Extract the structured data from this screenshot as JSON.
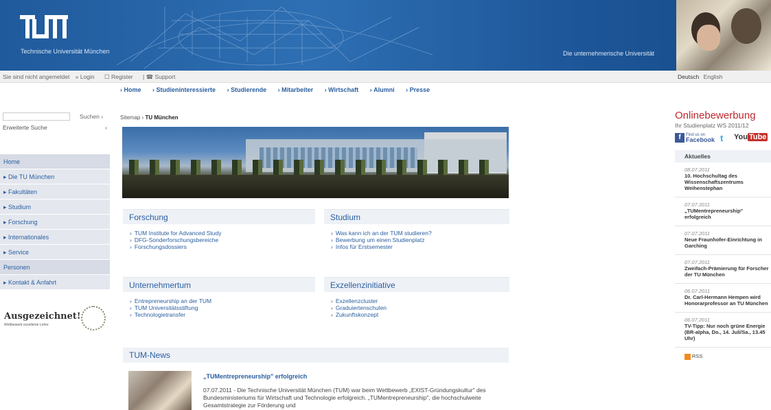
{
  "header": {
    "logo_text": "TUM",
    "university_name": "Technische Universität München",
    "slogan": "Die unternehmerische Universität"
  },
  "loginbar": {
    "status": "Sie sind nicht angemeldet",
    "login": "Login",
    "register": "Register",
    "support": "Support",
    "lang_de": "Deutsch",
    "lang_en": "English"
  },
  "topnav": [
    "Home",
    "Studieninteressierte",
    "Studierende",
    "Mitarbeiter",
    "Wirtschaft",
    "Alumni",
    "Presse"
  ],
  "sidebar": {
    "search_button": "Suchen",
    "advanced_search": "Erweiterte Suche",
    "items": [
      {
        "label": "Home",
        "arrow": false
      },
      {
        "label": "Die TU München",
        "arrow": true
      },
      {
        "label": "Fakultäten",
        "arrow": true
      },
      {
        "label": "Studium",
        "arrow": true
      },
      {
        "label": "Forschung",
        "arrow": true
      },
      {
        "label": "Internationales",
        "arrow": true
      },
      {
        "label": "Service",
        "arrow": true
      },
      {
        "label": "Personen",
        "arrow": false
      },
      {
        "label": "Kontakt & Anfahrt",
        "arrow": true
      }
    ],
    "award_title": "Ausgezeichnet!",
    "award_sub": "Wettbewerb exzellente Lehre"
  },
  "breadcrumb": {
    "root": "Sitemap",
    "current": "TU München"
  },
  "panels": {
    "forschung": {
      "title": "Forschung",
      "links": [
        "TUM Institute for Advanced Study",
        "DFG-Sonderforschungsbereiche",
        "Forschungsdossiers"
      ]
    },
    "studium": {
      "title": "Studium",
      "links": [
        "Was kann ich an der TUM studieren?",
        "Bewerbung um einen Studienplatz",
        "Infos für Erstsemester"
      ]
    },
    "unternehmertum": {
      "title": "Unternehmertum",
      "links": [
        "Entrepreneurship an der TUM",
        "TUM Universitätsstiftung",
        "Technologietransfer"
      ]
    },
    "exzellenz": {
      "title": "Exzellenzinitiative",
      "links": [
        "Exzellenzcluster",
        "Graduiertenschulen",
        "Zukunftskonzept"
      ]
    }
  },
  "news": {
    "heading": "TUM-News",
    "title": "„TUMentrepreneurship\" erfolgreich",
    "text": "07.07.2011 - Die Technische Universität München (TUM) war beim Wettbewerb „EXIST-Gründungskultur\" des Bundesministeriums für Wirtschaft und Technologie erfolgreich. „TUMentrepreneurship\", die hochschulweite Gesamtstrategie zur Förderung und"
  },
  "right": {
    "online_title": "Onlinebewerbung",
    "online_sub": "Ihr Studienplatz WS 2011/12",
    "facebook_small": "Find us on",
    "facebook": "Facebook",
    "twitter": "t",
    "youtube_you": "You",
    "youtube_tube": "Tube",
    "aktuelles": "Aktuelles",
    "items": [
      {
        "date": "08.07.2011",
        "title": "10. Hochschultag des Wissenschaftszentrums Weihenstephan"
      },
      {
        "date": "07.07.2011",
        "title": "„TUMentrepreneurship\" erfolgreich"
      },
      {
        "date": "07.07.2011",
        "title": "Neue Fraunhofer-Einrichtung in Garching"
      },
      {
        "date": "07.07.2011",
        "title": "Zweifach-Prämierung für Forscher der TU München"
      },
      {
        "date": "06.07.2011",
        "title": "Dr. Carl-Hermann Hempen wird Honorarprofessor an TU München"
      },
      {
        "date": "06.07.2011",
        "title": "TV-Tipp: Nur noch grüne Energie (BR-alpha, Do., 14. Juli/Sa., 13.45 Uhr)"
      }
    ],
    "rss": "RSS"
  }
}
